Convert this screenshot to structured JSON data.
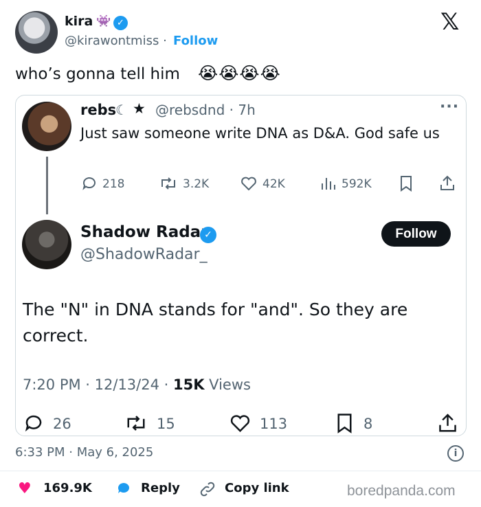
{
  "author": {
    "name": "kira",
    "name_emoji": "👾",
    "handle": "@kirawontmiss",
    "separator": "·",
    "follow_label": "Follow",
    "verified_mark": "✓"
  },
  "brand": {
    "logo": "𝕏"
  },
  "tweet": {
    "text": "who’s gonna tell him",
    "emojis": "😭😭😭😭"
  },
  "quote": {
    "reply_tweet": {
      "name": "rebs",
      "moon": "☾",
      "star": "★",
      "handle_time": "@rebsdnd · 7h",
      "more": "···",
      "text": "Just saw someone write DNA as D&A. God safe us",
      "stats": {
        "replies": "218",
        "reposts": "3.2K",
        "likes": "42K",
        "views": "592K"
      }
    },
    "main_tweet": {
      "name": "Shadow Radar",
      "verified_mark": "✓",
      "handle": "@ShadowRadar_",
      "follow_label": "Follow",
      "text": "The \"N\" in DNA stands for \"and\". So they are correct.",
      "time": "7:20 PM · 12/13/24 · ",
      "views_count": "15K",
      "views_label": " Views",
      "stats": {
        "replies": "26",
        "reposts": "15",
        "likes": "113",
        "bookmarks": "8"
      }
    }
  },
  "footer": {
    "timestamp": "6:33 PM · May 6, 2025",
    "likes": "169.9K",
    "reply_label": "Reply",
    "copy_label": "Copy link",
    "watermark": "boredpanda.com",
    "colors": {
      "like": "#f91880",
      "reply": "#1d9bf0",
      "accent": "#1d9bf0"
    }
  },
  "icons": {
    "reply": "reply-bubble-icon",
    "repost": "repost-icon",
    "like": "heart-icon",
    "views": "views-bars-icon",
    "bookmark": "bookmark-icon",
    "share": "share-icon"
  }
}
